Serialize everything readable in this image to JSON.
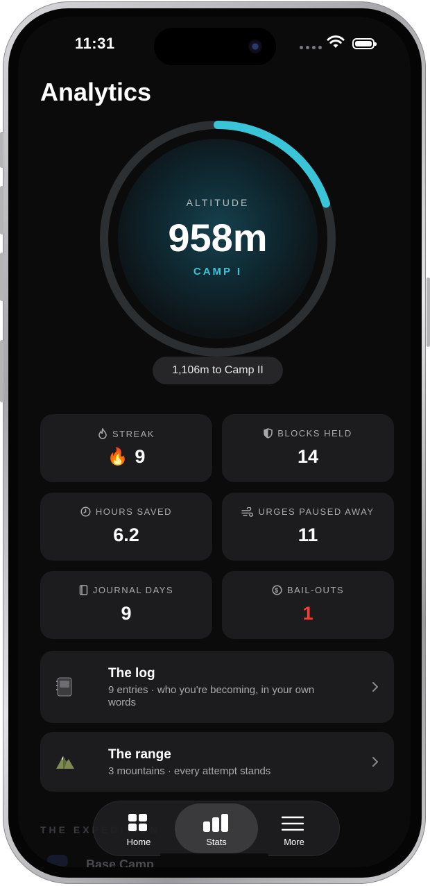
{
  "status_bar": {
    "time": "11:31"
  },
  "page_title": "Analytics",
  "altitude": {
    "label": "ALTITUDE",
    "value": "958m",
    "camp": "CAMP I",
    "progress": 0.2,
    "to_next": "1,106m to Camp II",
    "colors": {
      "accent": "#39c4d8",
      "track": "#2b2f31"
    }
  },
  "stats": {
    "streak": {
      "label": "STREAK",
      "value": "9",
      "icon": "flame-icon",
      "emoji": "🔥"
    },
    "blocks_held": {
      "label": "BLOCKS HELD",
      "value": "14",
      "icon": "shield-icon"
    },
    "hours_saved": {
      "label": "HOURS SAVED",
      "value": "6.2",
      "icon": "clock-icon"
    },
    "urges_paused_away": {
      "label": "URGES PAUSED AWAY",
      "value": "11",
      "icon": "wind-icon"
    },
    "journal_days": {
      "label": "JOURNAL DAYS",
      "value": "9",
      "icon": "book-icon"
    },
    "bail_outs": {
      "label": "BAIL-OUTS",
      "value": "1",
      "icon": "dollar-circle-icon",
      "color": "#ff3b30"
    }
  },
  "rows": {
    "log": {
      "title": "The log",
      "subtitle": "9 entries · who you're becoming, in your own words",
      "icon": "notebook-icon"
    },
    "range": {
      "title": "The range",
      "subtitle": "3 mountains · every attempt stands",
      "icon": "mountain-icon"
    }
  },
  "behind_tabbar": {
    "section_label": "THE EXPEDITION",
    "row_label": "Base Camp"
  },
  "tabbar": {
    "home": {
      "label": "Home",
      "icon": "grid-icon"
    },
    "stats": {
      "label": "Stats",
      "icon": "bar-chart-icon",
      "active": true
    },
    "more": {
      "label": "More",
      "icon": "menu-icon"
    }
  }
}
